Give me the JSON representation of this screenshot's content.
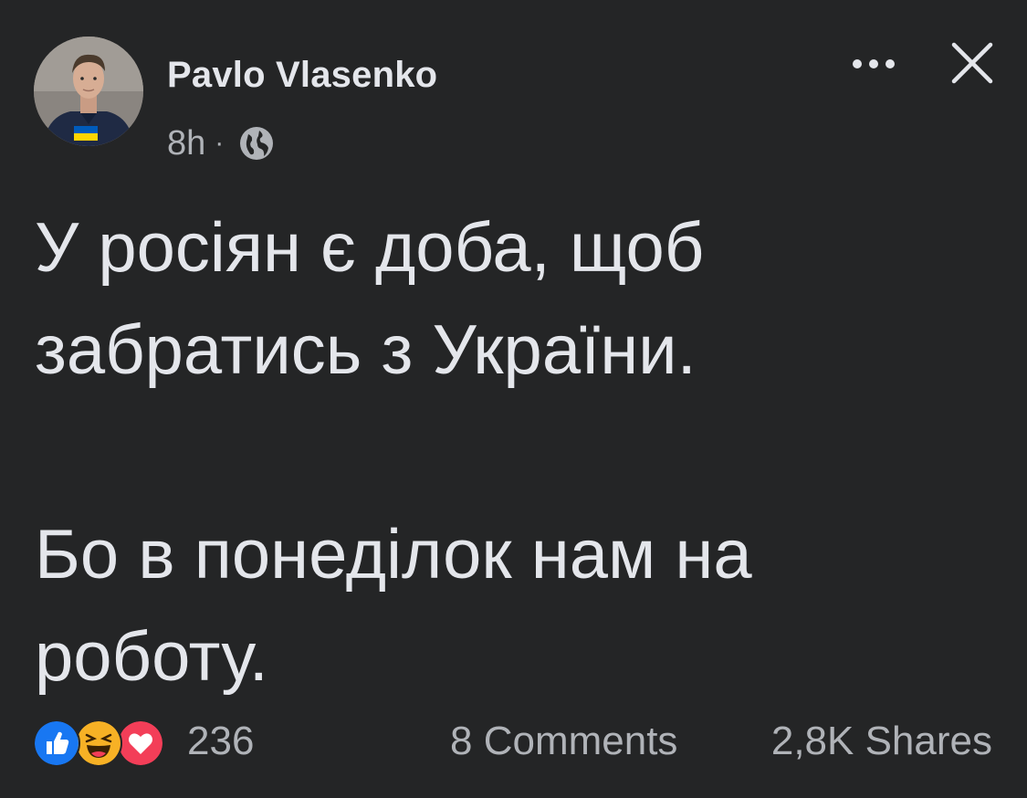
{
  "post": {
    "author": "Pavlo Vlasenko",
    "time": "8h",
    "separator": "·",
    "audience_icon": "globe-icon",
    "more_icon": "more-options-icon",
    "close_icon": "close-icon",
    "text_line1": "У росіян є доба, щоб",
    "text_line2": "забратись з України.",
    "text_line3": "Бо в понеділок нам на",
    "text_line4": "роботу."
  },
  "footer": {
    "reactions": [
      "like-reaction-icon",
      "haha-reaction-icon",
      "love-reaction-icon"
    ],
    "reaction_count": "236",
    "comments": "8 Comments",
    "shares": "2,8K Shares"
  },
  "colors": {
    "background": "#242526",
    "primary_text": "#e4e6eb",
    "secondary_text": "#b0b3b8",
    "like_blue": "#1877f2",
    "love_red": "#f33e58",
    "haha_yellow": "#f7b125",
    "flag_blue": "#005bbb",
    "flag_yellow": "#ffd500"
  }
}
